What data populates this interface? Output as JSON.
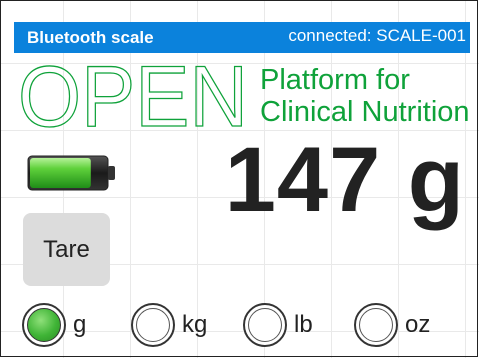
{
  "header": {
    "title": "Bluetooth scale",
    "status": "connected: SCALE-001"
  },
  "logo": {
    "word": "OPEN",
    "tagline_line1": "Platform for",
    "tagline_line2": "Clinical Nutrition"
  },
  "battery": {
    "icon": "battery-icon",
    "level": 0.8
  },
  "weight": {
    "display": "147 g"
  },
  "tare": {
    "label": "Tare"
  },
  "units": {
    "selected": "g",
    "options": [
      {
        "label": "g"
      },
      {
        "label": "kg"
      },
      {
        "label": "lb"
      },
      {
        "label": "oz"
      }
    ]
  },
  "colors": {
    "header_bg": "#0b82dc",
    "accent_green": "#0fa23a",
    "text": "#222222"
  }
}
